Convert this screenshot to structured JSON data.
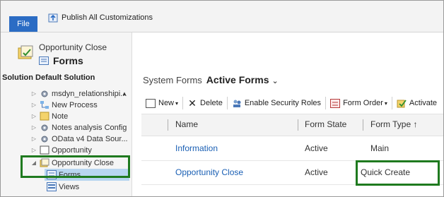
{
  "ribbon": {
    "file_label": "File",
    "publish_label": "Publish All Customizations"
  },
  "sidebar": {
    "entity_name": "Opportunity Close",
    "section_title": "Forms",
    "solution_label": "Solution Default Solution",
    "items": [
      {
        "label": "msdyn_relationshipi...",
        "icon": "gear-icon"
      },
      {
        "label": "New Process",
        "icon": "process-icon"
      },
      {
        "label": "Note",
        "icon": "note-icon"
      },
      {
        "label": "Notes analysis Config",
        "icon": "gear-icon"
      },
      {
        "label": "OData v4 Data Sour...",
        "icon": "gear-icon"
      },
      {
        "label": "Opportunity",
        "icon": "entity-icon"
      },
      {
        "label": "Opportunity Close",
        "icon": "entity-icon"
      },
      {
        "label": "Forms",
        "icon": "forms-icon"
      },
      {
        "label": "Views",
        "icon": "views-icon"
      }
    ]
  },
  "main": {
    "system_forms_label": "System Forms",
    "active_forms_label": "Active Forms",
    "toolbar": {
      "new_label": "New",
      "delete_label": "Delete",
      "security_label": "Enable Security Roles",
      "form_order_label": "Form Order",
      "activate_label": "Activate"
    },
    "columns": [
      "Name",
      "Form State",
      "Form Type ↑"
    ],
    "rows": [
      {
        "name": "Information",
        "state": "Active",
        "type": "Main"
      },
      {
        "name": "Opportunity Close",
        "state": "Active",
        "type": "Quick Create"
      }
    ]
  },
  "colors": {
    "accent": "#2b6cc4",
    "highlight": "#1f7a1f",
    "link": "#1a5fb4"
  }
}
